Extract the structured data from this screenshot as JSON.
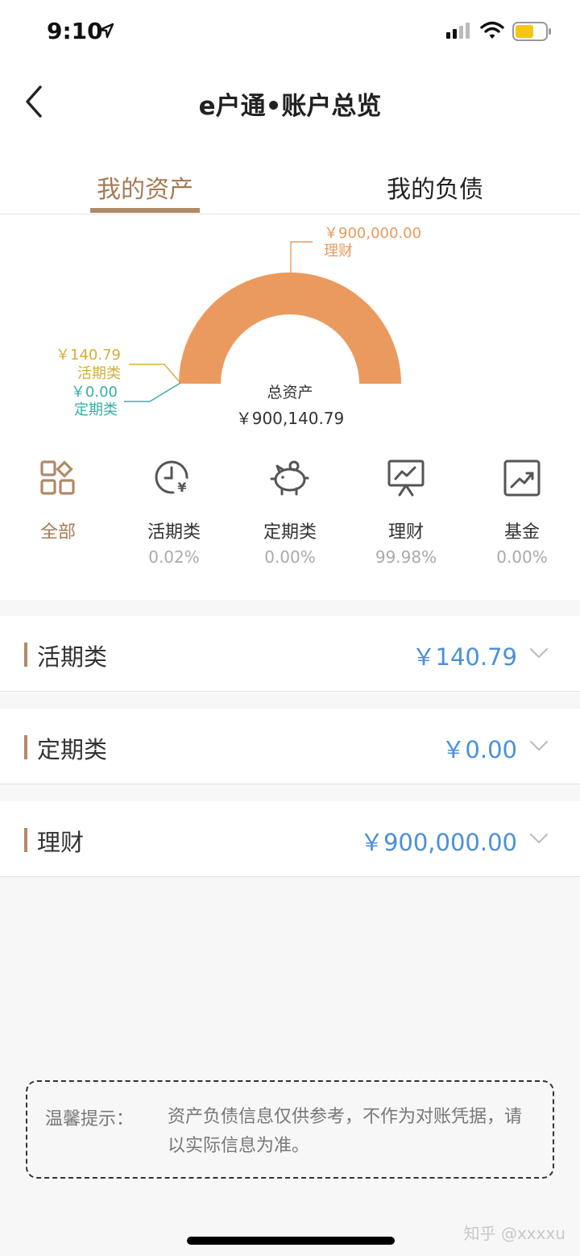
{
  "status_bar": {
    "time": "9:10"
  },
  "header": {
    "title": "e户通•账户总览"
  },
  "tabs": [
    {
      "label": "我的资产",
      "active": true
    },
    {
      "label": "我的负债",
      "active": false
    }
  ],
  "chart": {
    "licai_value": "￥900,000.00",
    "licai_name": "理财",
    "huoqi_value": "￥140.79",
    "huoqi_name": "活期类",
    "dingqi_value": "￥0.00",
    "dingqi_name": "定期类",
    "total_label": "总资产",
    "total_value": "￥900,140.79"
  },
  "chart_data": {
    "type": "pie",
    "categories": [
      "活期类",
      "定期类",
      "理财"
    ],
    "values": [
      140.79,
      0.0,
      900000.0
    ],
    "colors": [
      "#d4af37",
      "#3aaea7",
      "#eb9a5f"
    ]
  },
  "categories": [
    {
      "name": "全部",
      "percent": "",
      "icon": "grid-icon",
      "active": true
    },
    {
      "name": "活期类",
      "percent": "0.02%",
      "icon": "clock-yen-icon",
      "active": false
    },
    {
      "name": "定期类",
      "percent": "0.00%",
      "icon": "piggy-bank-icon",
      "active": false
    },
    {
      "name": "理财",
      "percent": "99.98%",
      "icon": "presentation-chart-icon",
      "active": false
    },
    {
      "name": "基金",
      "percent": "0.00%",
      "icon": "trend-chart-icon",
      "active": false
    }
  ],
  "rows": [
    {
      "label": "活期类",
      "value": "￥140.79"
    },
    {
      "label": "定期类",
      "value": "￥0.00"
    },
    {
      "label": "理财",
      "value": "￥900,000.00"
    }
  ],
  "tip": {
    "title": "温馨提示：",
    "text": "资产负债信息仅供参考，不作为对账凭据，请以实际信息为准。"
  },
  "watermark": "知乎 @xxxxu",
  "colors": {
    "accent": "#a57b55",
    "licai": "#eb9a5f",
    "huoqi": "#d4af37",
    "dingqi": "#3aaea7",
    "value_blue": "#4a90d9"
  }
}
